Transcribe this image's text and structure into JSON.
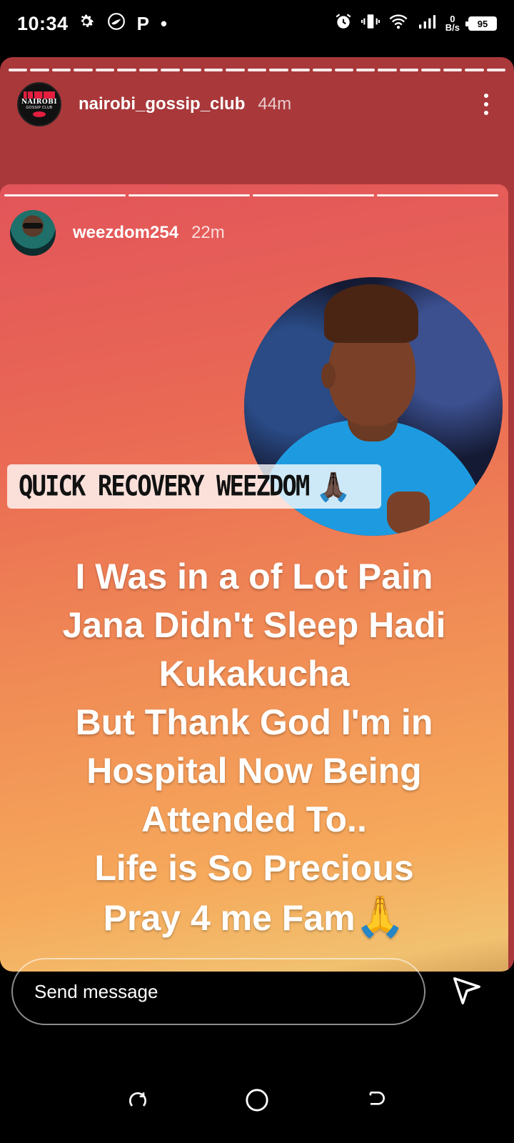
{
  "status_bar": {
    "time": "10:34",
    "left_icons": [
      "gear-icon",
      "bird-icon",
      "p-app-icon",
      "dot-icon"
    ],
    "p_glyph": "P",
    "dot_glyph": "•",
    "net_speed_value": "0",
    "net_speed_unit": "B/s",
    "battery_level": "95",
    "right_icons": [
      "alarm-icon",
      "vibrate-icon",
      "wifi-icon",
      "signal-icon",
      "battery-icon"
    ]
  },
  "outer_story": {
    "username": "nairobi_gossip_club",
    "time_ago": "44m",
    "avatar": {
      "brand": "NAIROBI",
      "sub": "GOSSIP CLUB"
    },
    "progress_segments": 23
  },
  "inner_story": {
    "username": "weezdom254",
    "time_ago": "22m",
    "progress_segments": 4,
    "caption": "QUICK RECOVERY WEEZDOM",
    "caption_emoji": "🙏🏿",
    "message_lines": [
      "I Was in a of Lot Pain",
      "Jana Didn't Sleep Hadi",
      "Kukakucha",
      "But Thank God I'm in",
      "Hospital Now Being",
      "Attended To..",
      "Life is So Precious",
      "Pray 4 me Fam"
    ],
    "final_emoji": "🙏"
  },
  "message_bar": {
    "placeholder": "Send message"
  },
  "colors": {
    "outer_story_bg": "#a9383a",
    "gradient_top": "#e2545a",
    "gradient_bottom": "#f6a95b",
    "brand_red": "#e41e3f",
    "jacket_blue": "#1e9be0"
  }
}
